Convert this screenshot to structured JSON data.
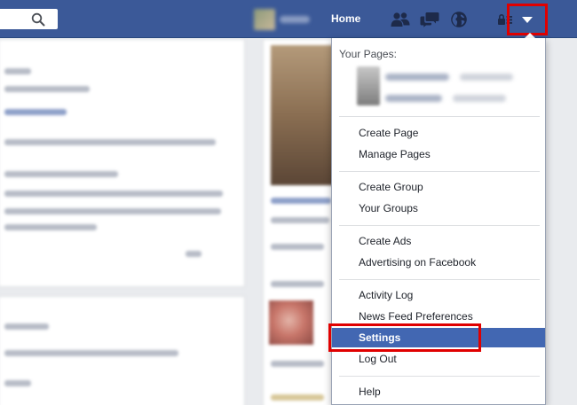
{
  "topbar": {
    "home_label": "Home"
  },
  "dropdown": {
    "header": "Your Pages:",
    "groups": [
      [
        "Create Page",
        "Manage Pages"
      ],
      [
        "Create Group",
        "Your Groups"
      ],
      [
        "Create Ads",
        "Advertising on Facebook"
      ],
      [
        "Activity Log",
        "News Feed Preferences",
        "Settings",
        "Log Out"
      ],
      [
        "Help"
      ]
    ],
    "items": {
      "create_page": "Create Page",
      "manage_pages": "Manage Pages",
      "create_group": "Create Group",
      "your_groups": "Your Groups",
      "create_ads": "Create Ads",
      "advertising": "Advertising on Facebook",
      "activity_log": "Activity Log",
      "news_feed_prefs": "News Feed Preferences",
      "settings": "Settings",
      "log_out": "Log Out",
      "help": "Help"
    },
    "active_item": "Settings"
  },
  "colors": {
    "brand": "#3b5998",
    "active": "#4267b2",
    "highlight": "#e00000"
  },
  "icons": [
    "search-icon",
    "friends-icon",
    "messages-icon",
    "globe-icon",
    "privacy-shortcuts-icon",
    "account-menu-icon"
  ]
}
